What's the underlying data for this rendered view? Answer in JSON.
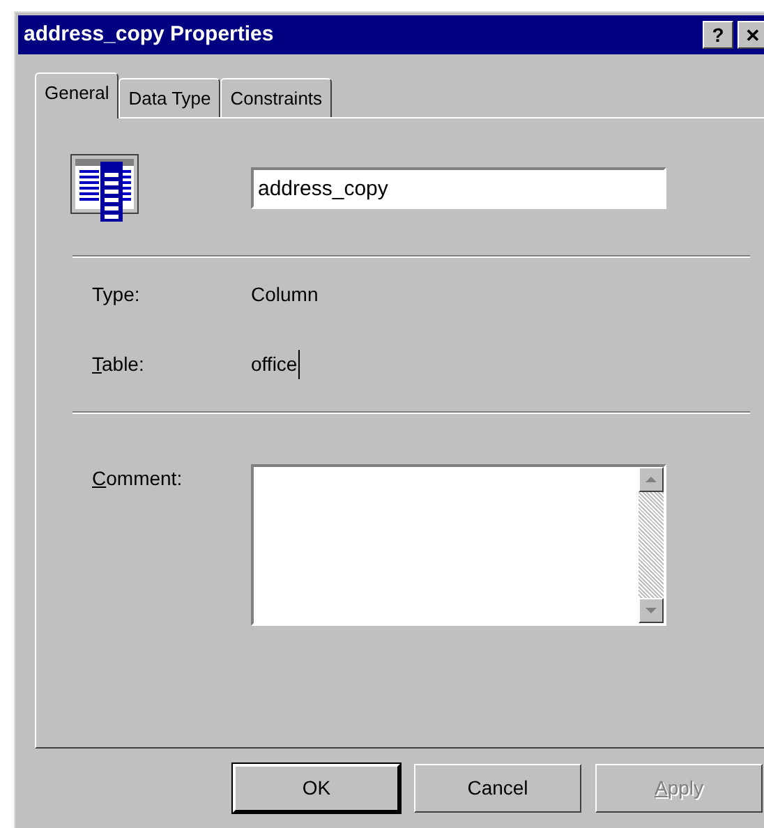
{
  "window": {
    "title": "address_copy Properties",
    "help_button": "?",
    "close_button": "✕"
  },
  "tabs": [
    {
      "label": "General",
      "selected": true
    },
    {
      "label": "Data Type",
      "selected": false
    },
    {
      "label": "Constraints",
      "selected": false
    }
  ],
  "name_field": {
    "value": "address_copy"
  },
  "info": [
    {
      "label": "Type:",
      "mnemonic": false,
      "value": "Column",
      "caret": false
    },
    {
      "label": "Table:",
      "mnemonic": true,
      "value": "office",
      "caret": true
    }
  ],
  "comment": {
    "label": "Comment:",
    "mnemonic": true
  },
  "buttons": [
    {
      "label": "OK",
      "disabled": false,
      "mnemonic": false,
      "default": true
    },
    {
      "label": "Cancel",
      "disabled": false,
      "mnemonic": false,
      "default": false
    },
    {
      "label": "Apply",
      "disabled": true,
      "mnemonic": true,
      "default": false
    }
  ]
}
